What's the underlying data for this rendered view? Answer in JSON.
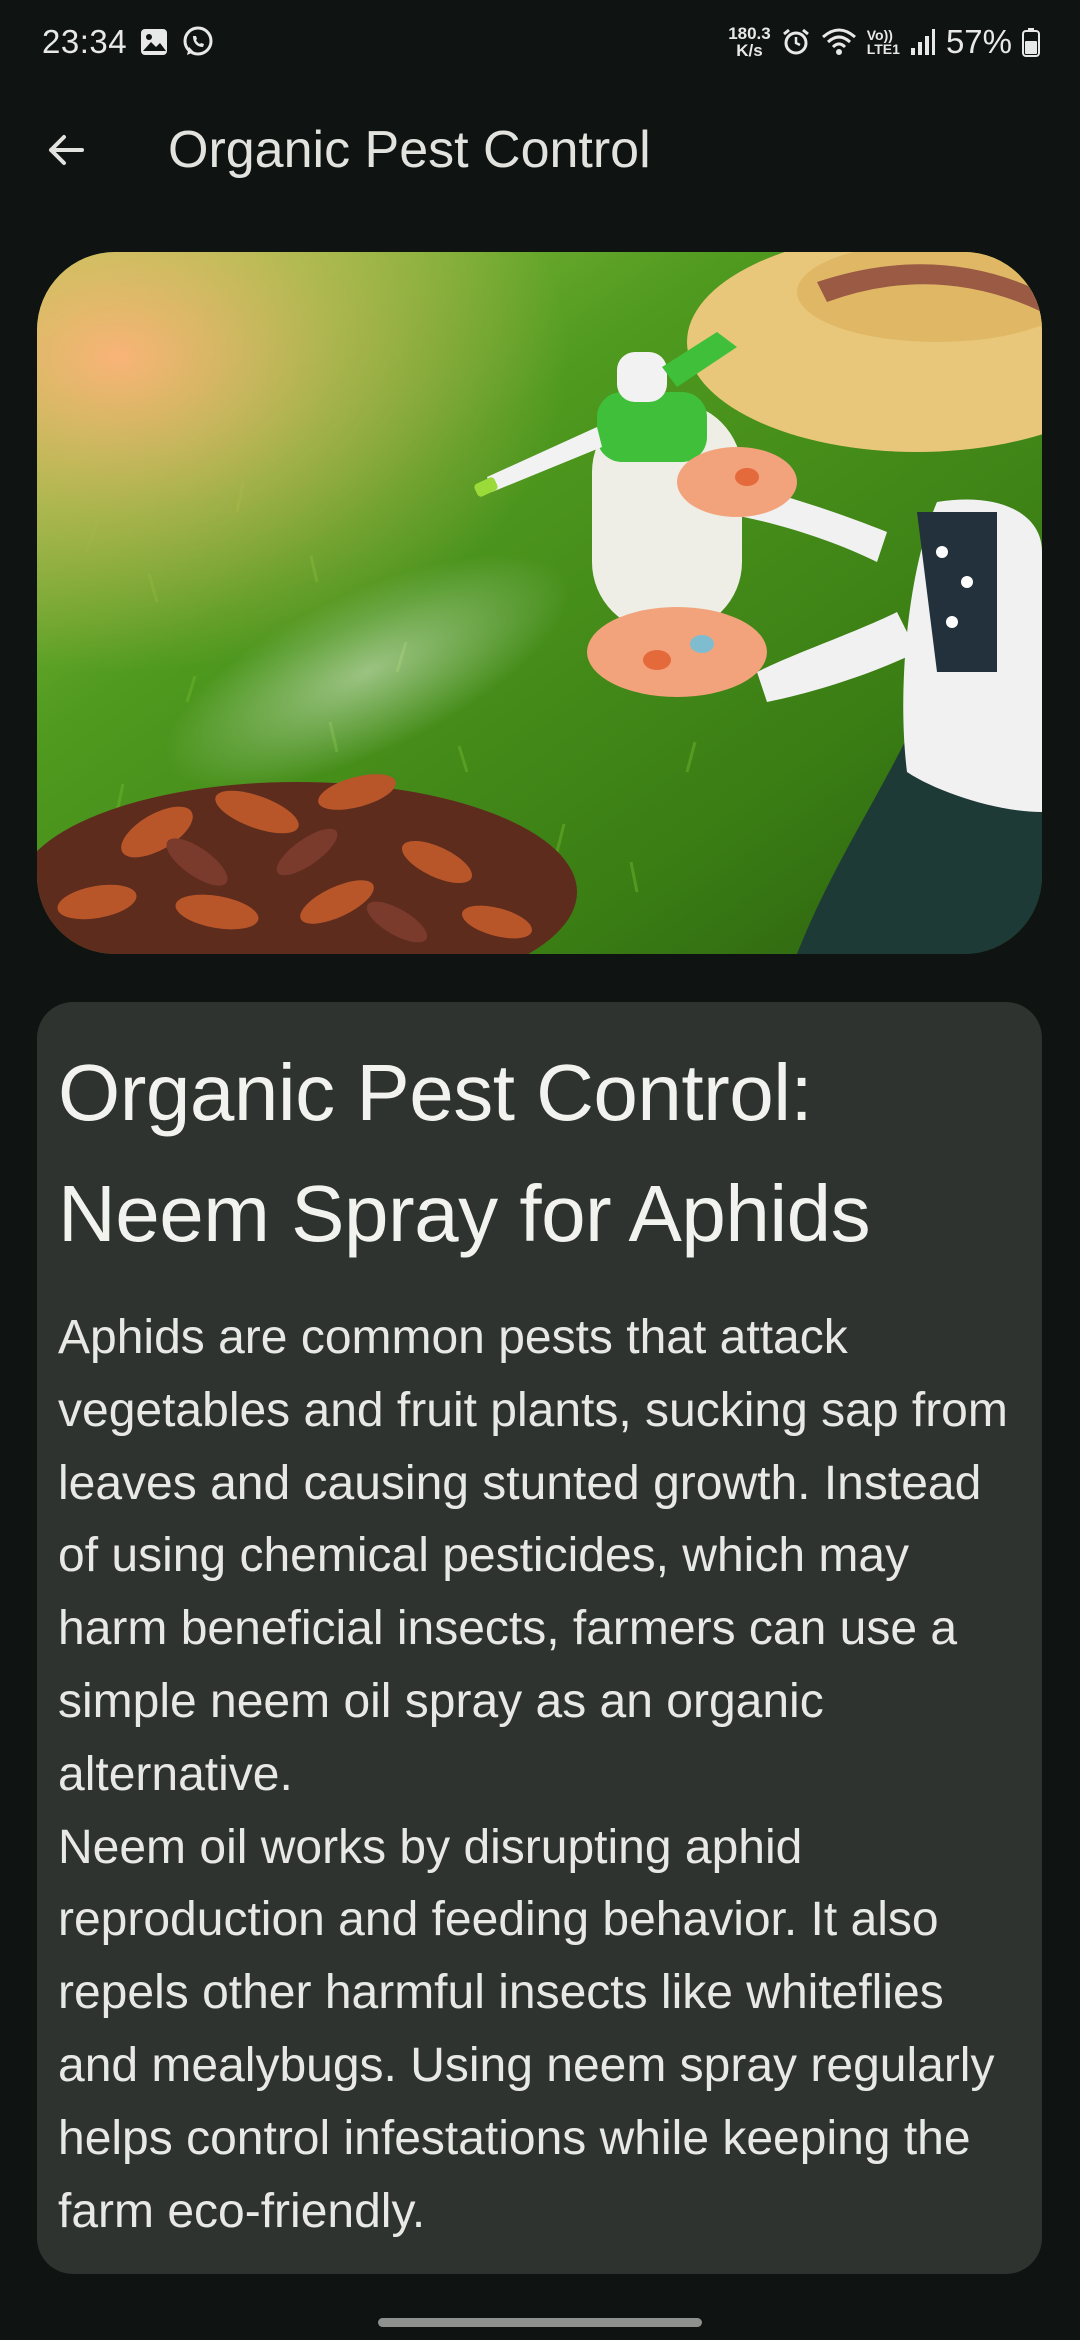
{
  "status_bar": {
    "time": "23:34",
    "net_speed_value": "180.3",
    "net_speed_unit": "K/s",
    "volte_top": "Vo))",
    "volte_bottom": "LTE1",
    "battery": "57%",
    "icons": [
      "gallery-icon",
      "whatsapp-icon",
      "alarm-icon",
      "wifi-icon",
      "signal-icon",
      "battery-icon"
    ]
  },
  "app_bar": {
    "back_icon": "arrow-left-icon",
    "title": "Organic Pest Control"
  },
  "hero_image": {
    "subject": "gardener-spraying-plants-image"
  },
  "article": {
    "title": "Organic Pest Control: Neem Spray for Aphids",
    "paragraphs": [
      "Aphids are common pests that attack vegetables and fruit plants, sucking sap from leaves and causing stunted growth. Instead of using chemical pesticides, which may harm beneficial insects, farmers can use a simple neem oil spray as an organic alternative.",
      "Neem oil works by disrupting aphid reproduction and feeding behavior. It also repels other harmful insects like whiteflies and mealybugs. Using neem spray regularly helps control infestations while keeping the farm eco-friendly."
    ]
  },
  "colors": {
    "background": "#0f1311",
    "card": "#2f3330",
    "text": "#e8e9e5"
  }
}
